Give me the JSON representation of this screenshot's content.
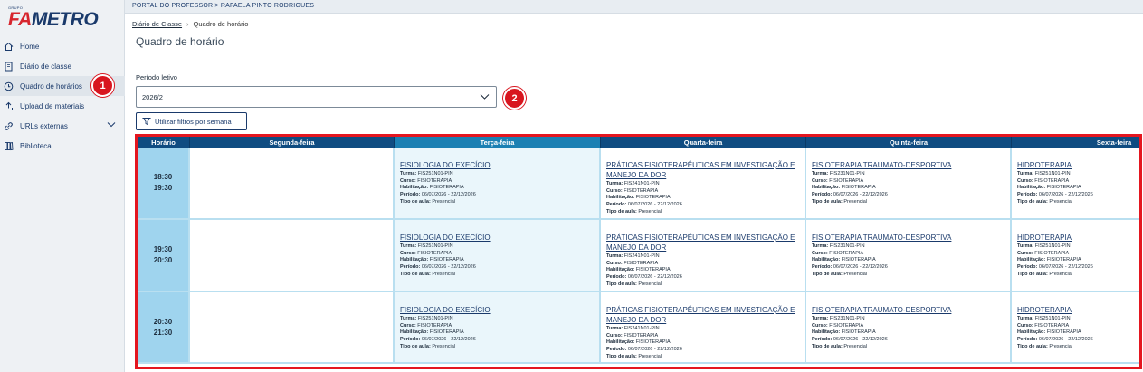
{
  "brand": {
    "group": "GRUPO",
    "name_prefix": "FA",
    "name_suffix": "METRO"
  },
  "topbar": {
    "path": "PORTAL DO PROFESSOR > RAFAELA PINTO RODRIGUES"
  },
  "nav": [
    {
      "label": "Home",
      "icon": "home-icon"
    },
    {
      "label": "Diário de classe",
      "icon": "book-icon"
    },
    {
      "label": "Quadro de horários",
      "icon": "clock-icon",
      "active": true
    },
    {
      "label": "Upload de materiais",
      "icon": "upload-icon"
    },
    {
      "label": "URLs externas",
      "icon": "link-icon",
      "expandable": true
    },
    {
      "label": "Biblioteca",
      "icon": "library-icon"
    }
  ],
  "badges": {
    "first": "1",
    "second": "2"
  },
  "breadcrumb": {
    "parent": "Diário de Classe",
    "separator": "›",
    "current": "Quadro de horário"
  },
  "page": {
    "title": "Quadro de horário"
  },
  "period": {
    "label": "Período letivo",
    "value": "2026/2"
  },
  "filter_button": {
    "label": "Utilizar filtros por semana",
    "icon": "filter-icon"
  },
  "schedule": {
    "headers": [
      "Horário",
      "Segunda-feira",
      "Terça-feira",
      "Quarta-feira",
      "Quinta-feira",
      "Sexta-feira"
    ],
    "field_labels": {
      "turma": "Turma:",
      "curso": "Curso:",
      "habilitacao": "Habilitação:",
      "periodo": "Período:",
      "tipo": "Tipo de aula:"
    },
    "rows": [
      {
        "start": "18:30",
        "end": "19:30",
        "days": [
          null,
          {
            "name": "FISIOLOGIA DO EXECÍCIO",
            "turma": "FIS251N01-PIN",
            "curso": "FISIOTERAPIA",
            "habilitacao": "FISIOTERAPIA",
            "periodo": "06/07/2026 - 22/12/2026",
            "tipo": "Presencial"
          },
          {
            "name": "PRÁTICAS FISIOTERAPÊUTICAS EM INVESTIGAÇÃO E MANEJO DA DOR",
            "turma": "FIS241N01-PIN",
            "curso": "FISIOTERAPIA",
            "habilitacao": "FISIOTERAPIA",
            "periodo": "06/07/2026 - 22/12/2026",
            "tipo": "Presencial"
          },
          {
            "name": "FISIOTERAPIA TRAUMATO-DESPORTIVA",
            "turma": "FIS231N01-PIN",
            "curso": "FISIOTERAPIA",
            "habilitacao": "FISIOTERAPIA",
            "periodo": "06/07/2026 - 22/12/2026",
            "tipo": "Presencial"
          },
          {
            "name": "HIDROTERAPIA",
            "turma": "FIS251N01-PIN",
            "curso": "FISIOTERAPIA",
            "habilitacao": "FISIOTERAPIA",
            "periodo": "06/07/2026 - 22/12/2026",
            "tipo": "Presencial"
          }
        ]
      },
      {
        "start": "19:30",
        "end": "20:30",
        "days": [
          null,
          {
            "name": "FISIOLOGIA DO EXECÍCIO",
            "turma": "FIS251N01-PIN",
            "curso": "FISIOTERAPIA",
            "habilitacao": "FISIOTERAPIA",
            "periodo": "06/07/2026 - 22/12/2026",
            "tipo": "Presencial"
          },
          {
            "name": "PRÁTICAS FISIOTERAPÊUTICAS EM INVESTIGAÇÃO E MANEJO DA DOR",
            "turma": "FIS241N01-PIN",
            "curso": "FISIOTERAPIA",
            "habilitacao": "FISIOTERAPIA",
            "periodo": "06/07/2026 - 22/12/2026",
            "tipo": "Presencial"
          },
          {
            "name": "FISIOTERAPIA TRAUMATO-DESPORTIVA",
            "turma": "FIS231N01-PIN",
            "curso": "FISIOTERAPIA",
            "habilitacao": "FISIOTERAPIA",
            "periodo": "06/07/2026 - 22/12/2026",
            "tipo": "Presencial"
          },
          {
            "name": "HIDROTERAPIA",
            "turma": "FIS251N01-PIN",
            "curso": "FISIOTERAPIA",
            "habilitacao": "FISIOTERAPIA",
            "periodo": "06/07/2026 - 22/12/2026",
            "tipo": "Presencial"
          }
        ]
      },
      {
        "start": "20:30",
        "end": "21:30",
        "days": [
          null,
          {
            "name": "FISIOLOGIA DO EXECÍCIO",
            "turma": "FIS251N01-PIN",
            "curso": "FISIOTERAPIA",
            "habilitacao": "FISIOTERAPIA",
            "periodo": "06/07/2026 - 22/12/2026",
            "tipo": "Presencial"
          },
          {
            "name": "PRÁTICAS FISIOTERAPÊUTICAS EM INVESTIGAÇÃO E MANEJO DA DOR",
            "turma": "FIS241N01-PIN",
            "curso": "FISIOTERAPIA",
            "habilitacao": "FISIOTERAPIA",
            "periodo": "06/07/2026 - 22/12/2026",
            "tipo": "Presencial"
          },
          {
            "name": "FISIOTERAPIA TRAUMATO-DESPORTIVA",
            "turma": "FIS231N01-PIN",
            "curso": "FISIOTERAPIA",
            "habilitacao": "FISIOTERAPIA",
            "periodo": "06/07/2026 - 22/12/2026",
            "tipo": "Presencial"
          },
          {
            "name": "HIDROTERAPIA",
            "turma": "FIS251N01-PIN",
            "curso": "FISIOTERAPIA",
            "habilitacao": "FISIOTERAPIA",
            "periodo": "06/07/2026 - 22/12/2026",
            "tipo": "Presencial"
          }
        ]
      }
    ]
  },
  "colors": {
    "primary": "#0F4C81",
    "highlight_header": "#1B80B3",
    "time_cell": "#9FD4EE",
    "alert": "#D8161F"
  }
}
